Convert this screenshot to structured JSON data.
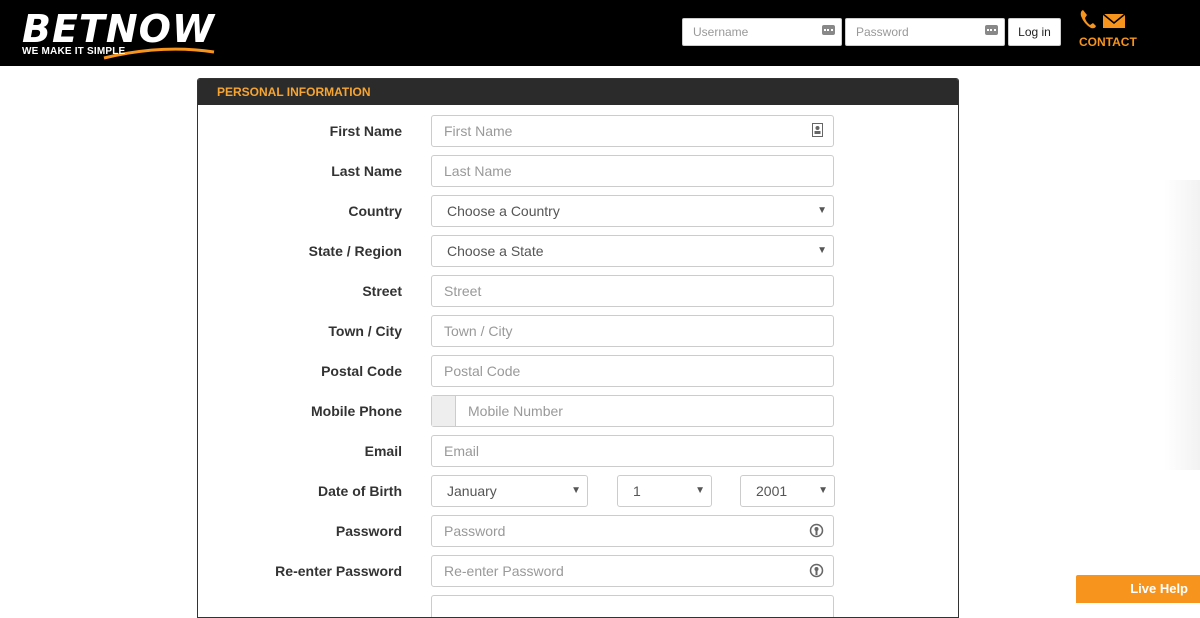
{
  "header": {
    "logo_text": "BETNOW",
    "logo_tagline": "WE MAKE IT SIMPLE",
    "username_placeholder": "Username",
    "password_placeholder": "Password",
    "login_label": "Log in",
    "contact_label": "CONTACT",
    "accent_color": "#f7941d"
  },
  "form": {
    "section_title": "PERSONAL INFORMATION",
    "first_name": {
      "label": "First Name",
      "placeholder": "First Name"
    },
    "last_name": {
      "label": "Last Name",
      "placeholder": "Last Name"
    },
    "country": {
      "label": "Country",
      "value": "Choose a Country"
    },
    "state": {
      "label": "State / Region",
      "value": "Choose a State"
    },
    "street": {
      "label": "Street",
      "placeholder": "Street"
    },
    "town": {
      "label": "Town / City",
      "placeholder": "Town / City"
    },
    "postal": {
      "label": "Postal Code",
      "placeholder": "Postal Code"
    },
    "mobile": {
      "label": "Mobile Phone",
      "placeholder": "Mobile Number"
    },
    "email": {
      "label": "Email",
      "placeholder": "Email"
    },
    "dob": {
      "label": "Date of Birth",
      "month": "January",
      "day": "1",
      "year": "2001"
    },
    "password": {
      "label": "Password",
      "placeholder": "Password"
    },
    "password2": {
      "label": "Re-enter Password",
      "placeholder": "Re-enter Password"
    }
  },
  "live_help_label": "Live Help"
}
